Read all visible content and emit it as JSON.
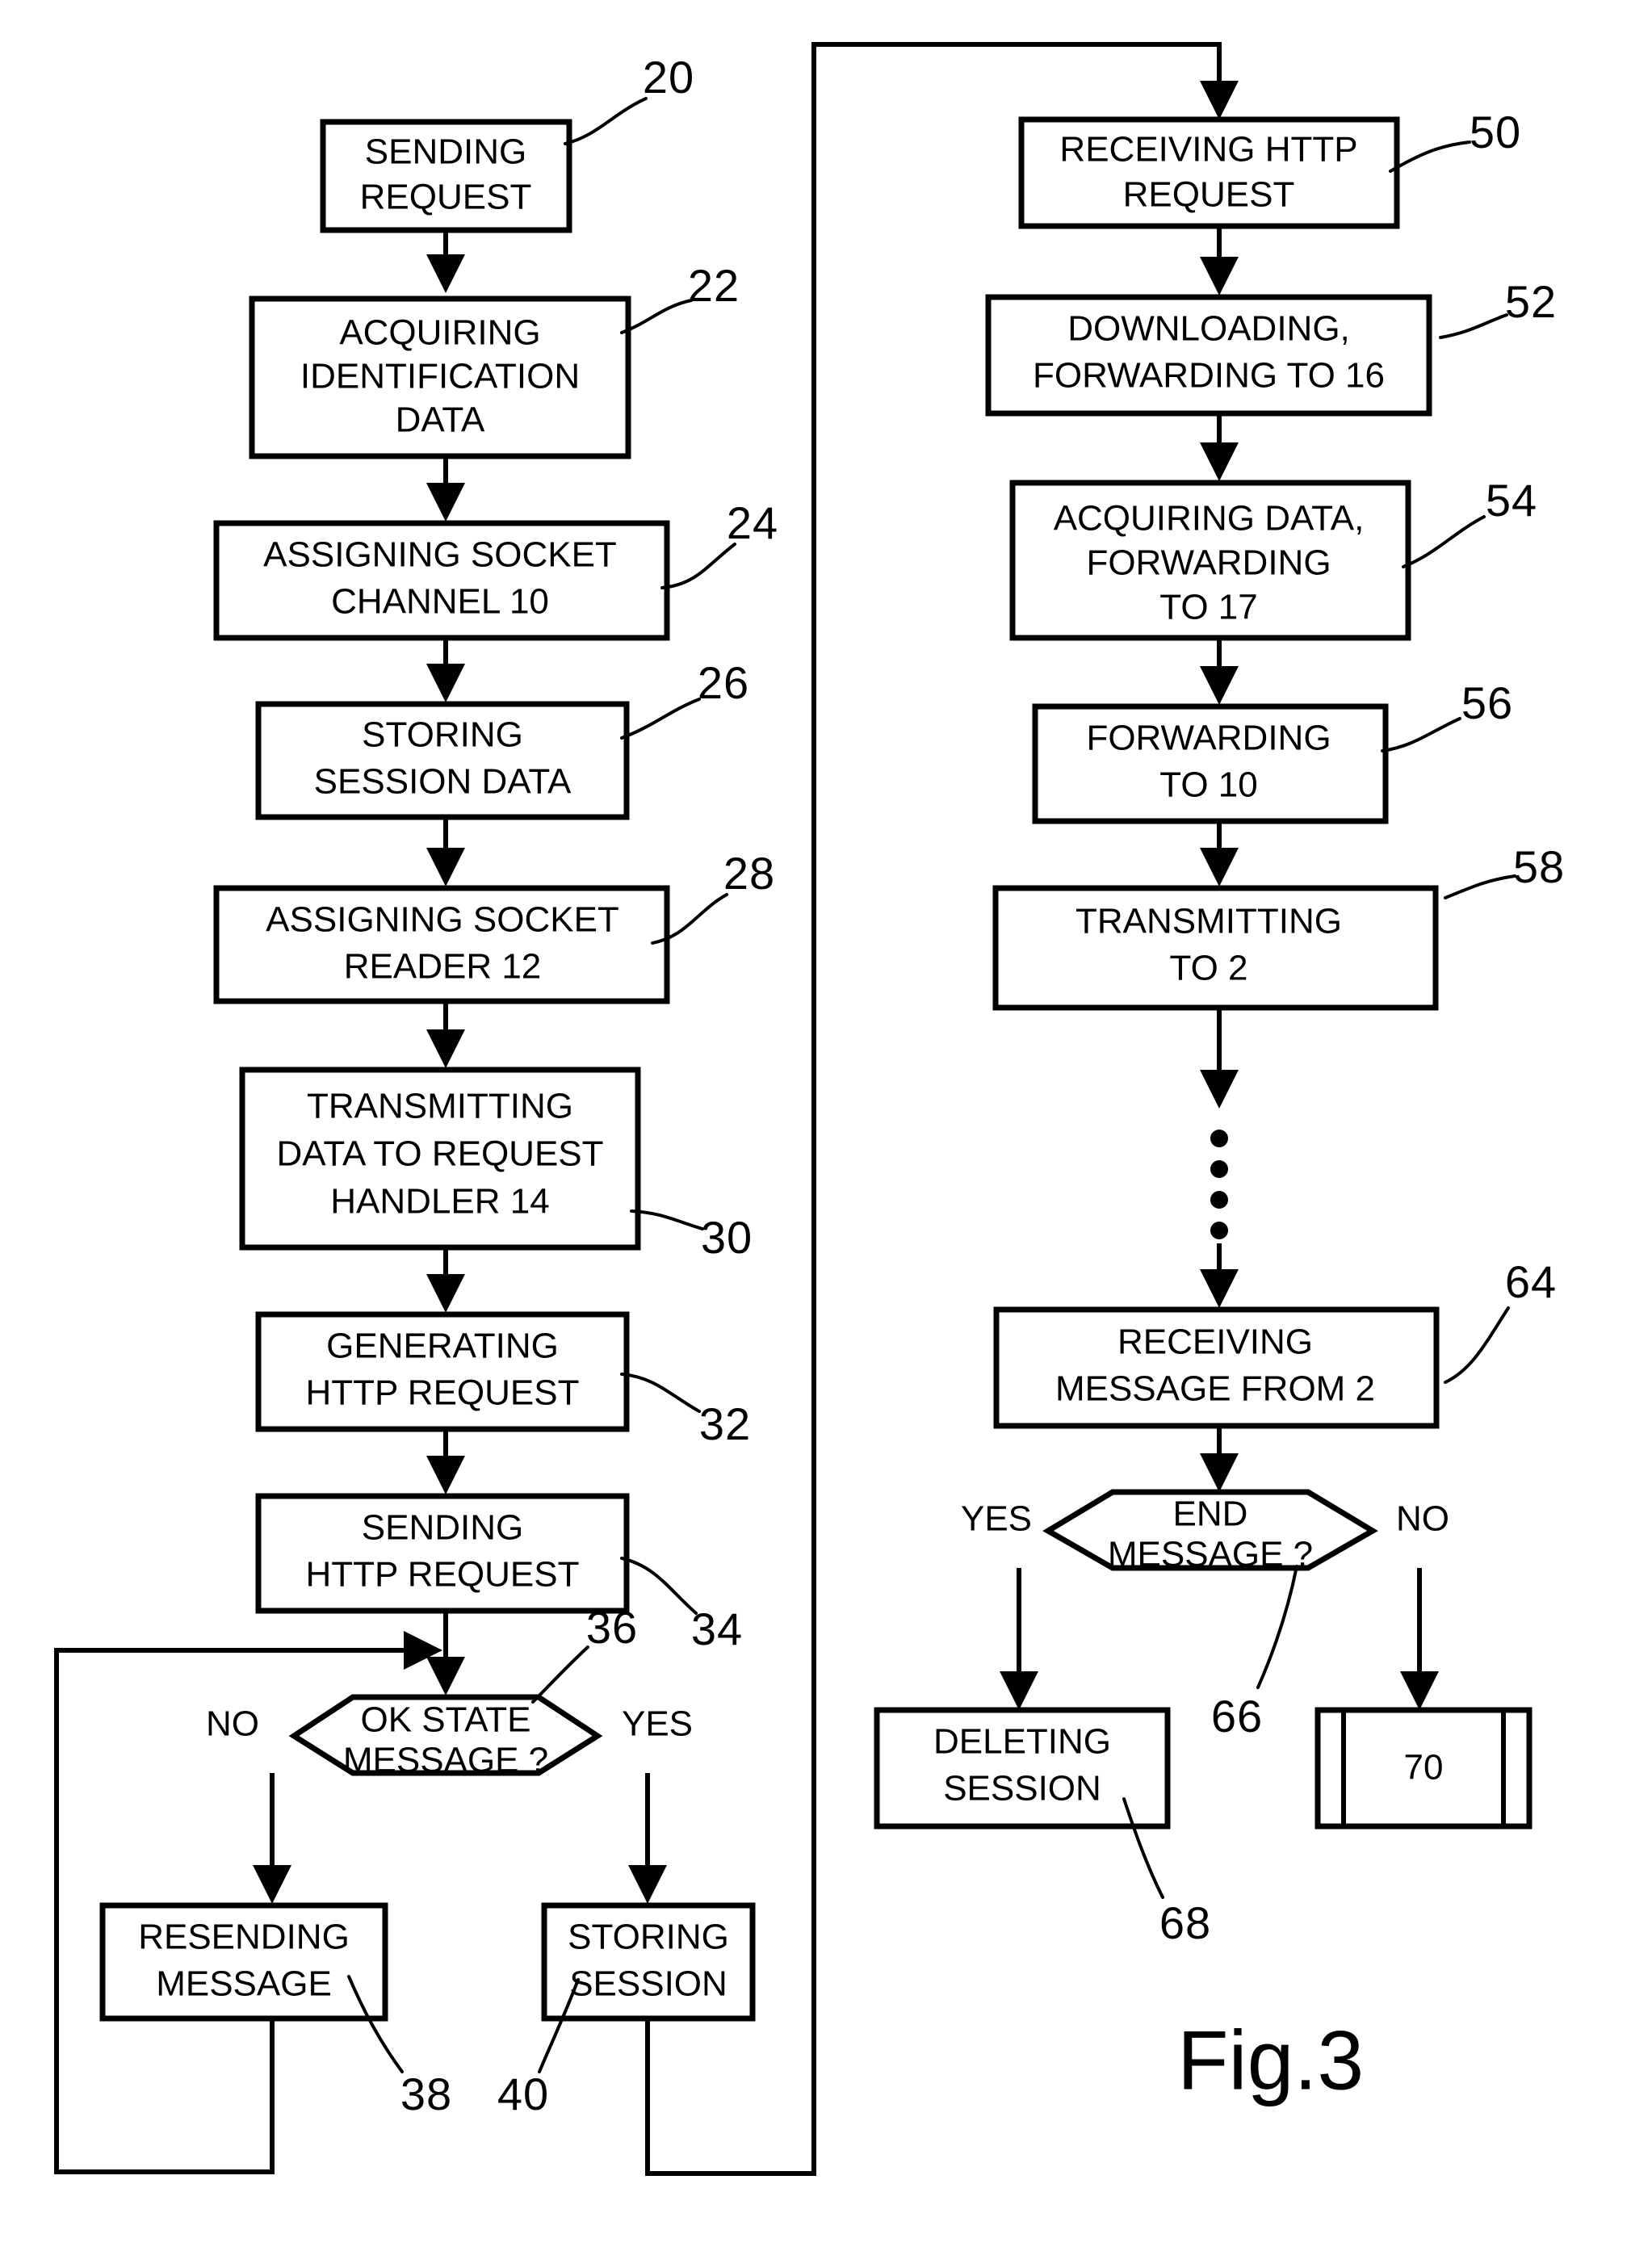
{
  "figure": {
    "label": "Fig.3",
    "title": "Fig.3",
    "type": "patent-flowchart"
  },
  "chart_data": {
    "type": "diagram",
    "title": "Fig.3",
    "nodes": [
      {
        "id": "20",
        "ref": "20",
        "shape": "process",
        "column": "left",
        "lines": [
          "SENDING",
          "REQUEST"
        ]
      },
      {
        "id": "22",
        "ref": "22",
        "shape": "process",
        "column": "left",
        "lines": [
          "ACQUIRING",
          "IDENTIFICATION",
          "DATA"
        ]
      },
      {
        "id": "24",
        "ref": "24",
        "shape": "process",
        "column": "left",
        "lines": [
          "ASSIGNING SOCKET",
          "CHANNEL 10"
        ]
      },
      {
        "id": "26",
        "ref": "26",
        "shape": "process",
        "column": "left",
        "lines": [
          "STORING",
          "SESSION DATA"
        ]
      },
      {
        "id": "28",
        "ref": "28",
        "shape": "process",
        "column": "left",
        "lines": [
          "ASSIGNING SOCKET",
          "READER 12"
        ]
      },
      {
        "id": "30",
        "ref": "30",
        "shape": "process",
        "column": "left",
        "lines": [
          "TRANSMITTING",
          "DATA TO REQUEST",
          "HANDLER 14"
        ]
      },
      {
        "id": "32",
        "ref": "32",
        "shape": "process",
        "column": "left",
        "lines": [
          "GENERATING",
          "HTTP REQUEST"
        ]
      },
      {
        "id": "34",
        "ref": "34",
        "shape": "process",
        "column": "left",
        "lines": [
          "SENDING",
          "HTTP REQUEST"
        ]
      },
      {
        "id": "36",
        "ref": "36",
        "shape": "decision",
        "column": "left",
        "lines": [
          "OK STATE",
          "MESSAGE ?"
        ]
      },
      {
        "id": "38",
        "ref": "38",
        "shape": "process",
        "column": "left",
        "lines": [
          "RESENDING",
          "MESSAGE"
        ]
      },
      {
        "id": "40",
        "ref": "40",
        "shape": "process",
        "column": "left",
        "lines": [
          "STORING",
          "SESSION"
        ]
      },
      {
        "id": "50",
        "ref": "50",
        "shape": "process",
        "column": "right",
        "lines": [
          "RECEIVING HTTP",
          "REQUEST"
        ]
      },
      {
        "id": "52",
        "ref": "52",
        "shape": "process",
        "column": "right",
        "lines": [
          "DOWNLOADING,",
          "FORWARDING TO 16"
        ]
      },
      {
        "id": "54",
        "ref": "54",
        "shape": "process",
        "column": "right",
        "lines": [
          "ACQUIRING DATA,",
          "FORWARDING",
          "TO 17"
        ]
      },
      {
        "id": "56",
        "ref": "56",
        "shape": "process",
        "column": "right",
        "lines": [
          "FORWARDING",
          "TO 10"
        ]
      },
      {
        "id": "58",
        "ref": "58",
        "shape": "process",
        "column": "right",
        "lines": [
          "TRANSMITTING",
          "TO 2"
        ]
      },
      {
        "id": "64",
        "ref": "64",
        "shape": "process",
        "column": "right",
        "lines": [
          "RECEIVING",
          "MESSAGE FROM 2"
        ]
      },
      {
        "id": "66",
        "ref": "66",
        "shape": "decision",
        "column": "right",
        "lines": [
          "END",
          "MESSAGE ?"
        ]
      },
      {
        "id": "68",
        "ref": "68",
        "shape": "process",
        "column": "right",
        "lines": [
          "DELETING",
          "SESSION"
        ]
      },
      {
        "id": "70",
        "ref": "70",
        "shape": "predefined-process",
        "column": "right",
        "lines": [
          "70"
        ]
      }
    ],
    "edges": [
      {
        "from": "20",
        "to": "22",
        "label": ""
      },
      {
        "from": "22",
        "to": "24",
        "label": ""
      },
      {
        "from": "24",
        "to": "26",
        "label": ""
      },
      {
        "from": "26",
        "to": "28",
        "label": ""
      },
      {
        "from": "28",
        "to": "30",
        "label": ""
      },
      {
        "from": "30",
        "to": "32",
        "label": ""
      },
      {
        "from": "32",
        "to": "34",
        "label": ""
      },
      {
        "from": "34",
        "to": "36",
        "label": ""
      },
      {
        "from": "36",
        "to": "38",
        "label": "NO"
      },
      {
        "from": "36",
        "to": "40",
        "label": "YES"
      },
      {
        "from": "38",
        "to": "36",
        "label": ""
      },
      {
        "from": "40",
        "to": "50",
        "label": ""
      },
      {
        "from": "50",
        "to": "52",
        "label": ""
      },
      {
        "from": "52",
        "to": "54",
        "label": ""
      },
      {
        "from": "54",
        "to": "56",
        "label": ""
      },
      {
        "from": "56",
        "to": "58",
        "label": ""
      },
      {
        "from": "58",
        "to": "64",
        "label": ""
      },
      {
        "from": "64",
        "to": "66",
        "label": ""
      },
      {
        "from": "66",
        "to": "68",
        "label": "YES"
      },
      {
        "from": "66",
        "to": "70",
        "label": "NO"
      }
    ],
    "branch_labels": [
      "NO",
      "YES",
      "YES",
      "NO"
    ],
    "ellipsis": "vertical-dots-between-58-and-64"
  },
  "left_column": {
    "node_20": {
      "ref": "20",
      "line1": "SENDING",
      "line2": "REQUEST"
    },
    "node_22": {
      "ref": "22",
      "line1": "ACQUIRING",
      "line2": "IDENTIFICATION",
      "line3": "DATA"
    },
    "node_24": {
      "ref": "24",
      "line1": "ASSIGNING SOCKET",
      "line2": "CHANNEL 10"
    },
    "node_26": {
      "ref": "26",
      "line1": "STORING",
      "line2": "SESSION DATA"
    },
    "node_28": {
      "ref": "28",
      "line1": "ASSIGNING SOCKET",
      "line2": "READER 12"
    },
    "node_30": {
      "ref": "30",
      "line1": "TRANSMITTING",
      "line2": "DATA TO REQUEST",
      "line3": "HANDLER 14"
    },
    "node_32": {
      "ref": "32",
      "line1": "GENERATING",
      "line2": "HTTP REQUEST"
    },
    "node_34": {
      "ref": "34",
      "line1": "SENDING",
      "line2": "HTTP REQUEST"
    },
    "node_36": {
      "ref": "36",
      "line1": "OK STATE",
      "line2": "MESSAGE ?",
      "label_no": "NO",
      "label_yes": "YES"
    },
    "node_38": {
      "ref": "38",
      "line1": "RESENDING",
      "line2": "MESSAGE"
    },
    "node_40": {
      "ref": "40",
      "line1": "STORING",
      "line2": "SESSION"
    }
  },
  "right_column": {
    "node_50": {
      "ref": "50",
      "line1": "RECEIVING HTTP",
      "line2": "REQUEST"
    },
    "node_52": {
      "ref": "52",
      "line1": "DOWNLOADING,",
      "line2": "FORWARDING TO 16"
    },
    "node_54": {
      "ref": "54",
      "line1": "ACQUIRING DATA,",
      "line2": "FORWARDING",
      "line3": "TO 17"
    },
    "node_56": {
      "ref": "56",
      "line1": "FORWARDING",
      "line2": "TO 10"
    },
    "node_58": {
      "ref": "58",
      "line1": "TRANSMITTING",
      "line2": "TO 2"
    },
    "node_64": {
      "ref": "64",
      "line1": "RECEIVING",
      "line2": "MESSAGE FROM 2"
    },
    "node_66": {
      "ref": "66",
      "line1": "END",
      "line2": "MESSAGE ?",
      "label_yes": "YES",
      "label_no": "NO"
    },
    "node_68": {
      "ref": "68",
      "line1": "DELETING",
      "line2": "SESSION"
    },
    "node_70": {
      "ref": "70",
      "value": "70"
    }
  },
  "colors": {
    "ink": "#000000",
    "paper": "#ffffff"
  }
}
